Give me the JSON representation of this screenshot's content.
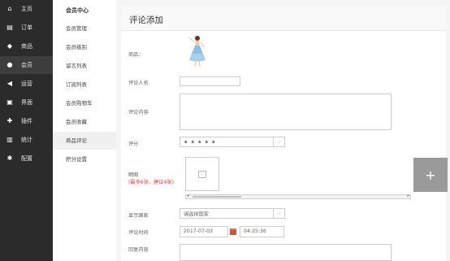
{
  "sidebar": {
    "items": [
      {
        "label": "主页",
        "icon": "home-icon",
        "glyph": "⌂"
      },
      {
        "label": "订单",
        "icon": "document-icon",
        "glyph": "▤"
      },
      {
        "label": "商品",
        "icon": "box-icon",
        "glyph": "◆"
      },
      {
        "label": "会员",
        "icon": "user-icon",
        "glyph": "●"
      },
      {
        "label": "运营",
        "icon": "megaphone-icon",
        "glyph": "◀"
      },
      {
        "label": "界面",
        "icon": "window-icon",
        "glyph": "▣"
      },
      {
        "label": "插件",
        "icon": "puzzle-icon",
        "glyph": "✚"
      },
      {
        "label": "统计",
        "icon": "bar-chart-icon",
        "glyph": "▥"
      },
      {
        "label": "配置",
        "icon": "gear-icon",
        "glyph": "✱"
      }
    ],
    "active_index": 3
  },
  "subnav": {
    "title": "会员中心",
    "items": [
      "会员管理",
      "会员级别",
      "留言列表",
      "订阅列表",
      "会员购物车",
      "会员收藏",
      "商品评论",
      "积分设置"
    ],
    "active_index": 6
  },
  "page": {
    "title": "评论添加"
  },
  "form": {
    "product_label": "商品：",
    "reviewer_label": "评论人名",
    "reviewer_value": "",
    "content_label": "评论内容",
    "content_value": "",
    "rating_label": "评分",
    "rating_value": "★ ★ ★ ★ ★",
    "images_label": "晒图",
    "images_hint": "(最多6张，建议4张)",
    "upload_icon": "image-placeholder-icon",
    "add_button": "+",
    "country_label": "显示国家",
    "country_placeholder": "请选择国家",
    "time_label": "评论时间",
    "date_value": "2017-07-03",
    "time_value": "04:25:36",
    "reply_label": "回复内容",
    "reply_value": ""
  },
  "colors": {
    "sidebar_bg": "#2b2b2b",
    "accent_red": "#e4393c",
    "calendar_icon": "#c8553d",
    "add_button_bg": "#9a9a9a"
  }
}
